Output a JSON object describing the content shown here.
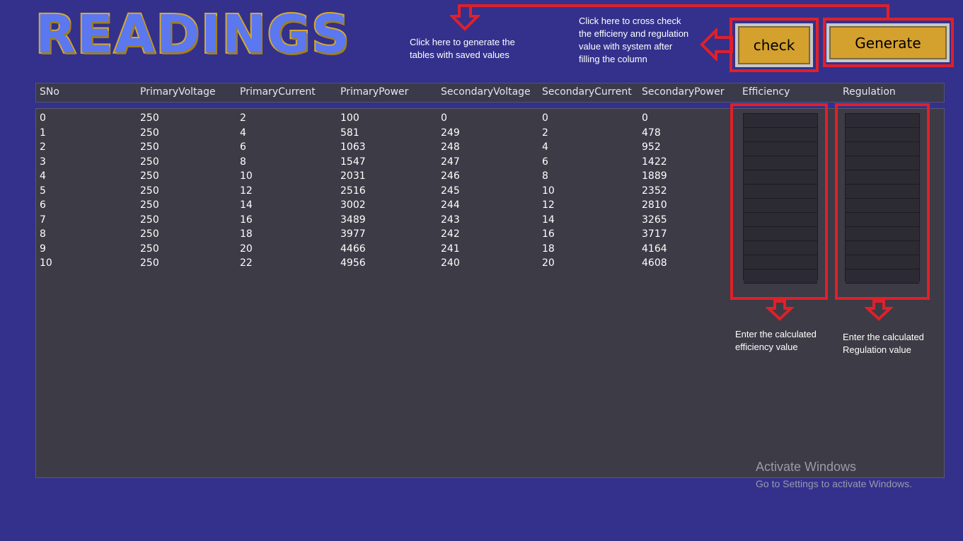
{
  "title": "READINGS",
  "notes": {
    "generate_hint": "Click here to generate the tables with saved values",
    "check_hint": "Click here to cross check the efficieny and regulation value with system after filling the column",
    "efficiency_hint": "Enter the calculated efficiency value",
    "regulation_hint": "Enter the calculated Regulation value"
  },
  "buttons": {
    "check": "check",
    "generate": "Generate"
  },
  "table": {
    "headers": [
      "SNo",
      "PrimaryVoltage",
      "PrimaryCurrent",
      "PrimaryPower",
      "SecondaryVoltage",
      "SecondaryCurrent",
      "SecondaryPower",
      "Efficiency",
      "Regulation"
    ],
    "rows": [
      [
        "0",
        "250",
        "2",
        "100",
        "0",
        "0",
        "0"
      ],
      [
        "1",
        "250",
        "4",
        "581",
        "249",
        "2",
        "478"
      ],
      [
        "2",
        "250",
        "6",
        "1063",
        "248",
        "4",
        "952"
      ],
      [
        "3",
        "250",
        "8",
        "1547",
        "247",
        "6",
        "1422"
      ],
      [
        "4",
        "250",
        "10",
        "2031",
        "246",
        "8",
        "1889"
      ],
      [
        "5",
        "250",
        "12",
        "2516",
        "245",
        "10",
        "2352"
      ],
      [
        "6",
        "250",
        "14",
        "3002",
        "244",
        "12",
        "2810"
      ],
      [
        "7",
        "250",
        "16",
        "3489",
        "243",
        "14",
        "3265"
      ],
      [
        "8",
        "250",
        "18",
        "3977",
        "242",
        "16",
        "3717"
      ],
      [
        "9",
        "250",
        "20",
        "4466",
        "241",
        "18",
        "4164"
      ],
      [
        "10",
        "250",
        "22",
        "4956",
        "240",
        "20",
        "4608"
      ]
    ]
  },
  "watermark": {
    "line1": "Activate Windows",
    "line2": "Go to Settings to activate Windows."
  },
  "colors": {
    "background": "#33318c",
    "button": "#d4a02e",
    "annotation": "#e0202a"
  }
}
